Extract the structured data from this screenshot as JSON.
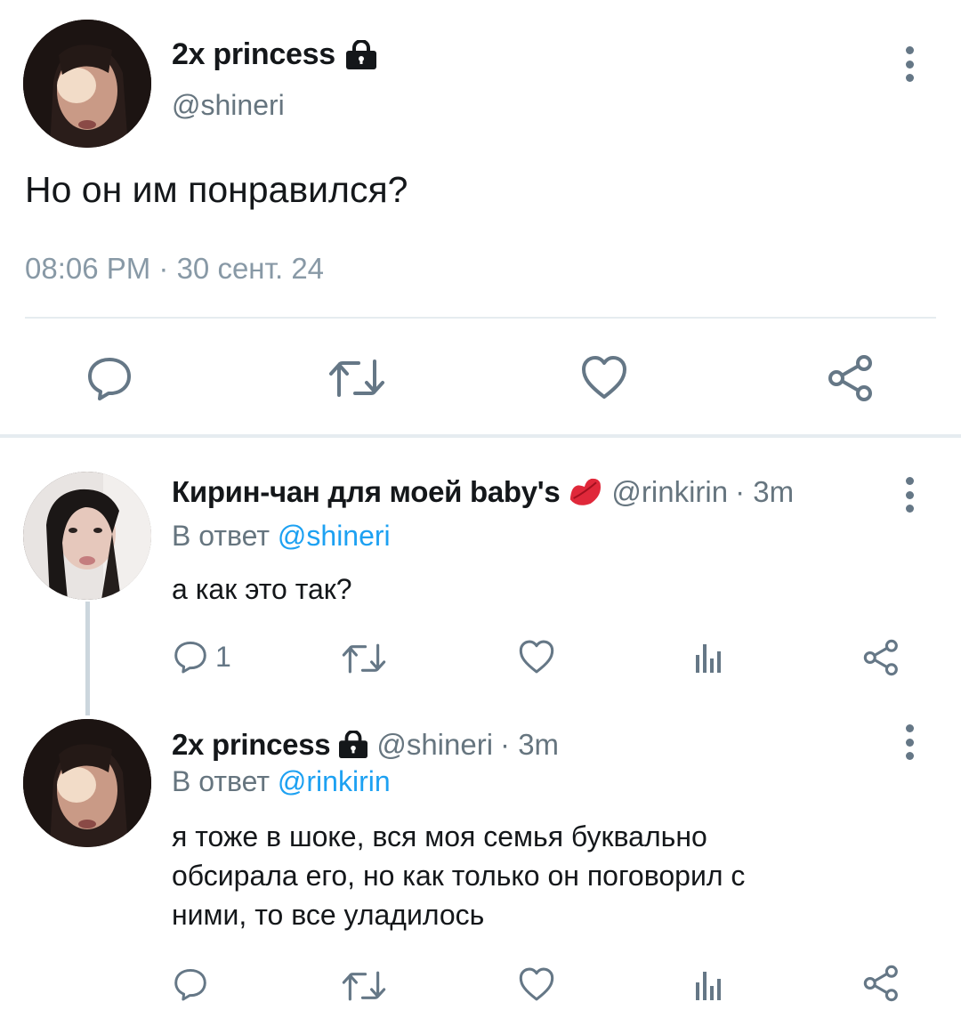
{
  "main_tweet": {
    "name": "2x princess",
    "handle": "@shineri",
    "text": "Но он им понравился?",
    "timestamp": "08:06 PM · 30 сент. 24"
  },
  "replies": [
    {
      "name": "Кирин-чан для моей baby's",
      "handle": "@rinkirin",
      "time": "· 3m",
      "reply_prefix": "В ответ",
      "reply_mention": "@shineri",
      "text": "а как это так?",
      "reply_count": "1"
    },
    {
      "name": "2x princess",
      "handle": "@shineri",
      "time": "· 3m",
      "reply_prefix": "В ответ",
      "reply_mention": "@rinkirin",
      "text_lines": [
        "я тоже в шоке, вся моя семья буквально",
        "обсирала его, но как только он поговорил с",
        "ними, то все уладилось"
      ]
    }
  ],
  "colors": {
    "text": "#14171a",
    "secondary": "#66757f",
    "mention": "#1da1f2",
    "icon": "#657786"
  }
}
